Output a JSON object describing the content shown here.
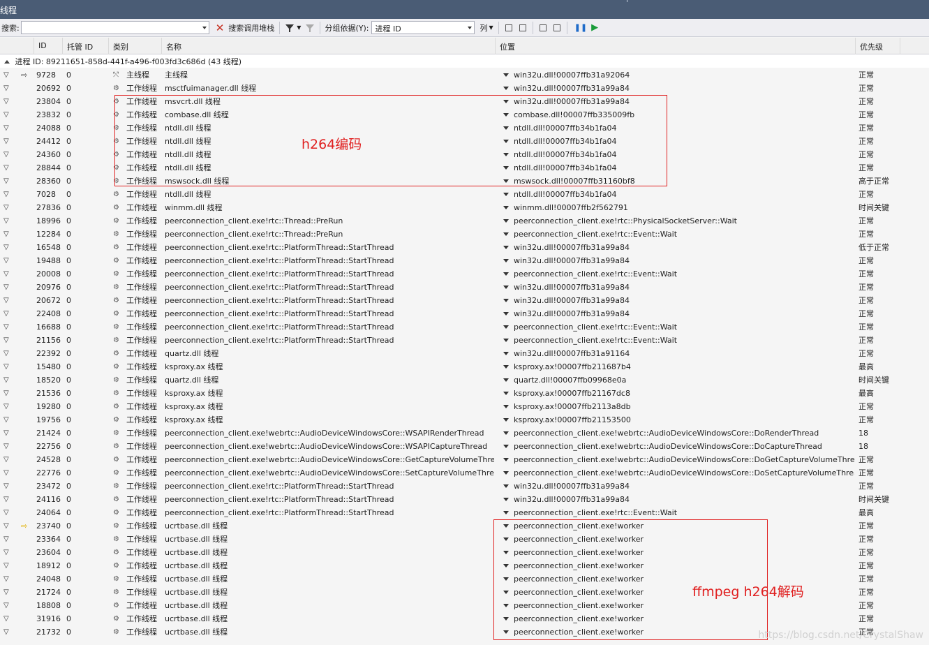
{
  "window": {
    "title": "线程"
  },
  "toolbar": {
    "search_label": "搜索:",
    "search_value": "",
    "search_callstack_label": "搜索调用堆栈",
    "group_by_label": "分组依据(Y):",
    "group_by_value": "进程 ID",
    "columns_label": "列"
  },
  "columns": {
    "id": "ID",
    "managed_id": "托管 ID",
    "category": "类别",
    "name": "名称",
    "location": "位置",
    "priority": "优先级"
  },
  "group": {
    "label": "进程 ID: 89211651-858d-441f-a496-f003fd3c686d  (43 线程)"
  },
  "rows": [
    {
      "id": "9728",
      "mid": "0",
      "type": "主线程",
      "name": "主线程",
      "loc": "win32u.dll!00007ffb31a92064",
      "pri": "正常",
      "arrow": "white",
      "main": true
    },
    {
      "id": "20692",
      "mid": "0",
      "type": "工作线程",
      "name": "msctfuimanager.dll 线程",
      "loc": "win32u.dll!00007ffb31a99a84",
      "pri": "正常"
    },
    {
      "id": "23804",
      "mid": "0",
      "type": "工作线程",
      "name": "msvcrt.dll 线程",
      "loc": "win32u.dll!00007ffb31a99a84",
      "pri": "正常"
    },
    {
      "id": "23832",
      "mid": "0",
      "type": "工作线程",
      "name": "combase.dll 线程",
      "loc": "combase.dll!00007ffb335009fb",
      "pri": "正常"
    },
    {
      "id": "24088",
      "mid": "0",
      "type": "工作线程",
      "name": "ntdll.dll 线程",
      "loc": "ntdll.dll!00007ffb34b1fa04",
      "pri": "正常"
    },
    {
      "id": "24412",
      "mid": "0",
      "type": "工作线程",
      "name": "ntdll.dll 线程",
      "loc": "ntdll.dll!00007ffb34b1fa04",
      "pri": "正常"
    },
    {
      "id": "24360",
      "mid": "0",
      "type": "工作线程",
      "name": "ntdll.dll 线程",
      "loc": "ntdll.dll!00007ffb34b1fa04",
      "pri": "正常"
    },
    {
      "id": "28844",
      "mid": "0",
      "type": "工作线程",
      "name": "ntdll.dll 线程",
      "loc": "ntdll.dll!00007ffb34b1fa04",
      "pri": "正常"
    },
    {
      "id": "28360",
      "mid": "0",
      "type": "工作线程",
      "name": "mswsock.dll 线程",
      "loc": "mswsock.dll!00007ffb31160bf8",
      "pri": "高于正常"
    },
    {
      "id": "7028",
      "mid": "0",
      "type": "工作线程",
      "name": "ntdll.dll 线程",
      "loc": "ntdll.dll!00007ffb34b1fa04",
      "pri": "正常"
    },
    {
      "id": "27836",
      "mid": "0",
      "type": "工作线程",
      "name": "winmm.dll 线程",
      "loc": "winmm.dll!00007ffb2f562791",
      "pri": "时间关键"
    },
    {
      "id": "18996",
      "mid": "0",
      "type": "工作线程",
      "name": "peerconnection_client.exe!rtc::Thread::PreRun",
      "loc": "peerconnection_client.exe!rtc::PhysicalSocketServer::Wait",
      "pri": "正常"
    },
    {
      "id": "12284",
      "mid": "0",
      "type": "工作线程",
      "name": "peerconnection_client.exe!rtc::Thread::PreRun",
      "loc": "peerconnection_client.exe!rtc::Event::Wait",
      "pri": "正常"
    },
    {
      "id": "16548",
      "mid": "0",
      "type": "工作线程",
      "name": "peerconnection_client.exe!rtc::PlatformThread::StartThread",
      "loc": "win32u.dll!00007ffb31a99a84",
      "pri": "低于正常"
    },
    {
      "id": "19488",
      "mid": "0",
      "type": "工作线程",
      "name": "peerconnection_client.exe!rtc::PlatformThread::StartThread",
      "loc": "win32u.dll!00007ffb31a99a84",
      "pri": "正常"
    },
    {
      "id": "20008",
      "mid": "0",
      "type": "工作线程",
      "name": "peerconnection_client.exe!rtc::PlatformThread::StartThread",
      "loc": "peerconnection_client.exe!rtc::Event::Wait",
      "pri": "正常"
    },
    {
      "id": "20976",
      "mid": "0",
      "type": "工作线程",
      "name": "peerconnection_client.exe!rtc::PlatformThread::StartThread",
      "loc": "win32u.dll!00007ffb31a99a84",
      "pri": "正常"
    },
    {
      "id": "20672",
      "mid": "0",
      "type": "工作线程",
      "name": "peerconnection_client.exe!rtc::PlatformThread::StartThread",
      "loc": "win32u.dll!00007ffb31a99a84",
      "pri": "正常"
    },
    {
      "id": "22408",
      "mid": "0",
      "type": "工作线程",
      "name": "peerconnection_client.exe!rtc::PlatformThread::StartThread",
      "loc": "win32u.dll!00007ffb31a99a84",
      "pri": "正常"
    },
    {
      "id": "16688",
      "mid": "0",
      "type": "工作线程",
      "name": "peerconnection_client.exe!rtc::PlatformThread::StartThread",
      "loc": "peerconnection_client.exe!rtc::Event::Wait",
      "pri": "正常"
    },
    {
      "id": "21156",
      "mid": "0",
      "type": "工作线程",
      "name": "peerconnection_client.exe!rtc::PlatformThread::StartThread",
      "loc": "peerconnection_client.exe!rtc::Event::Wait",
      "pri": "正常"
    },
    {
      "id": "22392",
      "mid": "0",
      "type": "工作线程",
      "name": "quartz.dll 线程",
      "loc": "win32u.dll!00007ffb31a91164",
      "pri": "正常"
    },
    {
      "id": "15480",
      "mid": "0",
      "type": "工作线程",
      "name": "ksproxy.ax 线程",
      "loc": "ksproxy.ax!00007ffb211687b4",
      "pri": "最高"
    },
    {
      "id": "18520",
      "mid": "0",
      "type": "工作线程",
      "name": "quartz.dll 线程",
      "loc": "quartz.dll!00007ffb09968e0a",
      "pri": "时间关键"
    },
    {
      "id": "21536",
      "mid": "0",
      "type": "工作线程",
      "name": "ksproxy.ax 线程",
      "loc": "ksproxy.ax!00007ffb21167dc8",
      "pri": "最高"
    },
    {
      "id": "19280",
      "mid": "0",
      "type": "工作线程",
      "name": "ksproxy.ax 线程",
      "loc": "ksproxy.ax!00007ffb2113a8db",
      "pri": "正常"
    },
    {
      "id": "19756",
      "mid": "0",
      "type": "工作线程",
      "name": "ksproxy.ax 线程",
      "loc": "ksproxy.ax!00007ffb21153500",
      "pri": "正常"
    },
    {
      "id": "21424",
      "mid": "0",
      "type": "工作线程",
      "name": "peerconnection_client.exe!webrtc::AudioDeviceWindowsCore::WSAPIRenderThread",
      "loc": "peerconnection_client.exe!webrtc::AudioDeviceWindowsCore::DoRenderThread",
      "pri": "18"
    },
    {
      "id": "22756",
      "mid": "0",
      "type": "工作线程",
      "name": "peerconnection_client.exe!webrtc::AudioDeviceWindowsCore::WSAPICaptureThread",
      "loc": "peerconnection_client.exe!webrtc::AudioDeviceWindowsCore::DoCaptureThread",
      "pri": "18"
    },
    {
      "id": "24528",
      "mid": "0",
      "type": "工作线程",
      "name": "peerconnection_client.exe!webrtc::AudioDeviceWindowsCore::GetCaptureVolumeThread",
      "loc": "peerconnection_client.exe!webrtc::AudioDeviceWindowsCore::DoGetCaptureVolumeThread",
      "pri": "正常"
    },
    {
      "id": "22776",
      "mid": "0",
      "type": "工作线程",
      "name": "peerconnection_client.exe!webrtc::AudioDeviceWindowsCore::SetCaptureVolumeThread",
      "loc": "peerconnection_client.exe!webrtc::AudioDeviceWindowsCore::DoSetCaptureVolumeThread",
      "pri": "正常"
    },
    {
      "id": "23472",
      "mid": "0",
      "type": "工作线程",
      "name": "peerconnection_client.exe!rtc::PlatformThread::StartThread",
      "loc": "win32u.dll!00007ffb31a99a84",
      "pri": "正常"
    },
    {
      "id": "24116",
      "mid": "0",
      "type": "工作线程",
      "name": "peerconnection_client.exe!rtc::PlatformThread::StartThread",
      "loc": "win32u.dll!00007ffb31a99a84",
      "pri": "时间关键"
    },
    {
      "id": "24064",
      "mid": "0",
      "type": "工作线程",
      "name": "peerconnection_client.exe!rtc::PlatformThread::StartThread",
      "loc": "peerconnection_client.exe!rtc::Event::Wait",
      "pri": "最高"
    },
    {
      "id": "23740",
      "mid": "0",
      "type": "工作线程",
      "name": "ucrtbase.dll 线程",
      "loc": "peerconnection_client.exe!worker",
      "pri": "正常",
      "arrow": "yellow"
    },
    {
      "id": "23364",
      "mid": "0",
      "type": "工作线程",
      "name": "ucrtbase.dll 线程",
      "loc": "peerconnection_client.exe!worker",
      "pri": "正常"
    },
    {
      "id": "23604",
      "mid": "0",
      "type": "工作线程",
      "name": "ucrtbase.dll 线程",
      "loc": "peerconnection_client.exe!worker",
      "pri": "正常"
    },
    {
      "id": "18912",
      "mid": "0",
      "type": "工作线程",
      "name": "ucrtbase.dll 线程",
      "loc": "peerconnection_client.exe!worker",
      "pri": "正常"
    },
    {
      "id": "24048",
      "mid": "0",
      "type": "工作线程",
      "name": "ucrtbase.dll 线程",
      "loc": "peerconnection_client.exe!worker",
      "pri": "正常"
    },
    {
      "id": "21724",
      "mid": "0",
      "type": "工作线程",
      "name": "ucrtbase.dll 线程",
      "loc": "peerconnection_client.exe!worker",
      "pri": "正常"
    },
    {
      "id": "18808",
      "mid": "0",
      "type": "工作线程",
      "name": "ucrtbase.dll 线程",
      "loc": "peerconnection_client.exe!worker",
      "pri": "正常"
    },
    {
      "id": "31916",
      "mid": "0",
      "type": "工作线程",
      "name": "ucrtbase.dll 线程",
      "loc": "peerconnection_client.exe!worker",
      "pri": "正常"
    },
    {
      "id": "21732",
      "mid": "0",
      "type": "工作线程",
      "name": "ucrtbase.dll 线程",
      "loc": "peerconnection_client.exe!worker",
      "pri": "正常"
    }
  ],
  "annotations": {
    "encode_label": "h264编码",
    "decode_label": "ffmpeg h264解码",
    "color": "#e02020"
  },
  "watermark": "https://blog.csdn.net/CrystalShaw"
}
